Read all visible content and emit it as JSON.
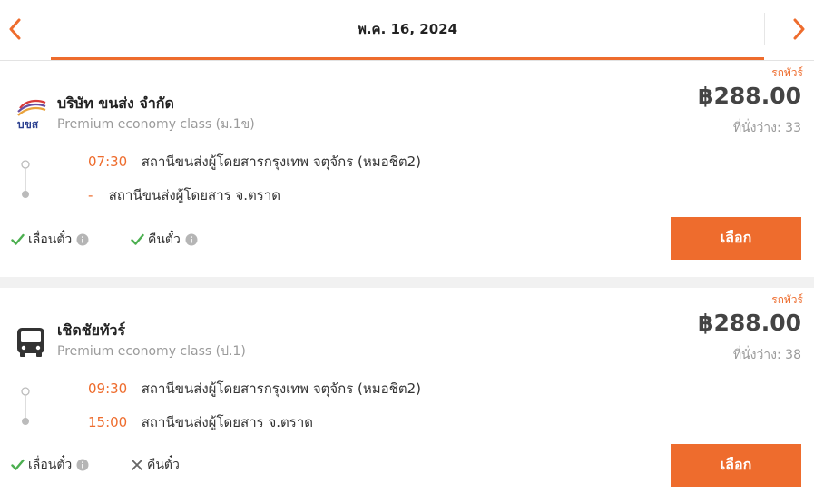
{
  "header": {
    "date": "พ.ค. 16, 2024"
  },
  "trips": [
    {
      "tag": "รถทัวร์",
      "company": "บริษัท ขนส่ง จำกัด",
      "class": "Premium economy class (ม.1ข)",
      "price": "฿288.00",
      "seats": "ที่นั่งว่าง: 33",
      "depart_time": "07:30",
      "depart_station": "สถานีขนส่งผู้โดยสารกรุงเทพ จตุจักร (หมอชิต2)",
      "arrive_time": "-",
      "arrive_station": "สถานีขนส่งผู้โดยสาร จ.ตราด",
      "feature1": "เลื่อนตั๋ว",
      "feature2": "คืนตั๋ว",
      "select": "เลือก"
    },
    {
      "tag": "รถทัวร์",
      "company": "เชิดชัยทัวร์",
      "class": "Premium economy class (ป.1)",
      "price": "฿288.00",
      "seats": "ที่นั่งว่าง: 38",
      "depart_time": "09:30",
      "depart_station": "สถานีขนส่งผู้โดยสารกรุงเทพ จตุจักร (หมอชิต2)",
      "arrive_time": "15:00",
      "arrive_station": "สถานีขนส่งผู้โดยสาร จ.ตราด",
      "feature1": "เลื่อนตั๋ว",
      "feature2": "คืนตั๋ว",
      "select": "เลือก"
    }
  ],
  "logos": {
    "company1_text": "บขส"
  },
  "colors": {
    "accent": "#ee6c2d",
    "check": "#4caf50"
  }
}
